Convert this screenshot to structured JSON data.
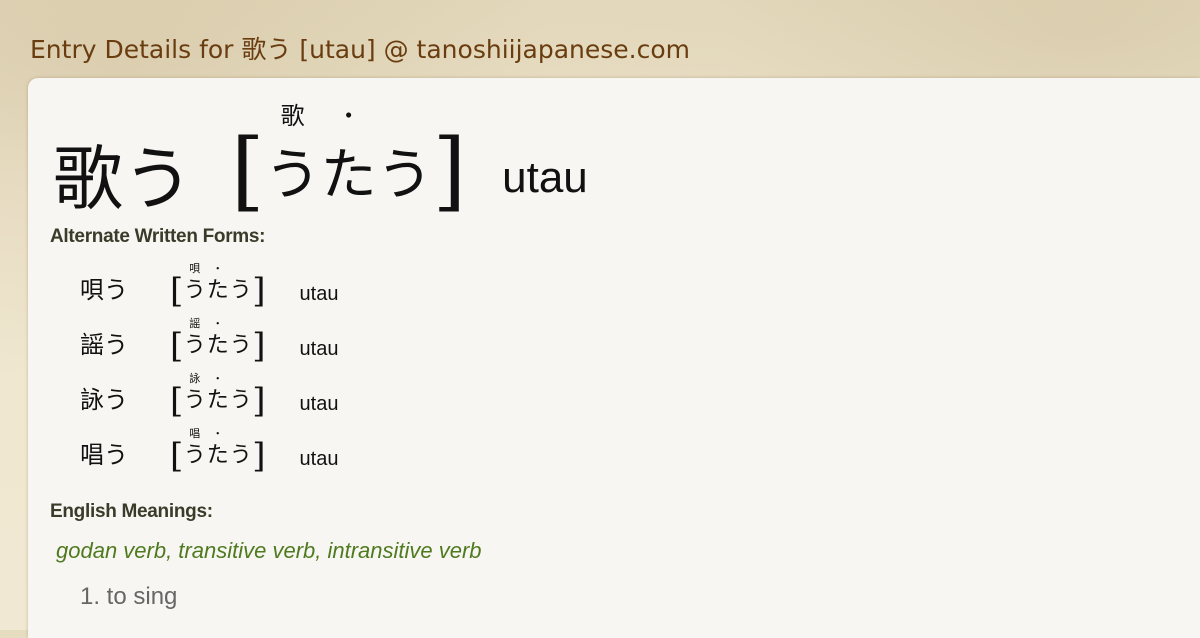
{
  "page_title": "Entry Details for 歌う [utau] @ tanoshiijapanese.com",
  "entry": {
    "word": "歌う",
    "reading_kana": [
      "う",
      "た",
      "う"
    ],
    "reading_furigana": [
      "歌",
      "・",
      ""
    ],
    "romaji": "utau",
    "bracket_open": "[",
    "bracket_close": "]"
  },
  "alternate": {
    "label": "Alternate Written Forms:",
    "items": [
      {
        "word": "唄う",
        "kana": [
          "う",
          "た",
          "う"
        ],
        "furigana": [
          "唄",
          "・",
          ""
        ],
        "romaji": "utau"
      },
      {
        "word": "謡う",
        "kana": [
          "う",
          "た",
          "う"
        ],
        "furigana": [
          "謡",
          "・",
          ""
        ],
        "romaji": "utau"
      },
      {
        "word": "詠う",
        "kana": [
          "う",
          "た",
          "う"
        ],
        "furigana": [
          "詠",
          "・",
          ""
        ],
        "romaji": "utau"
      },
      {
        "word": "唱う",
        "kana": [
          "う",
          "た",
          "う"
        ],
        "furigana": [
          "唱",
          "・",
          ""
        ],
        "romaji": "utau"
      }
    ]
  },
  "meanings": {
    "label": "English Meanings:",
    "part_of_speech": "godan verb, transitive verb, intransitive verb",
    "items": [
      "1. to sing"
    ]
  }
}
